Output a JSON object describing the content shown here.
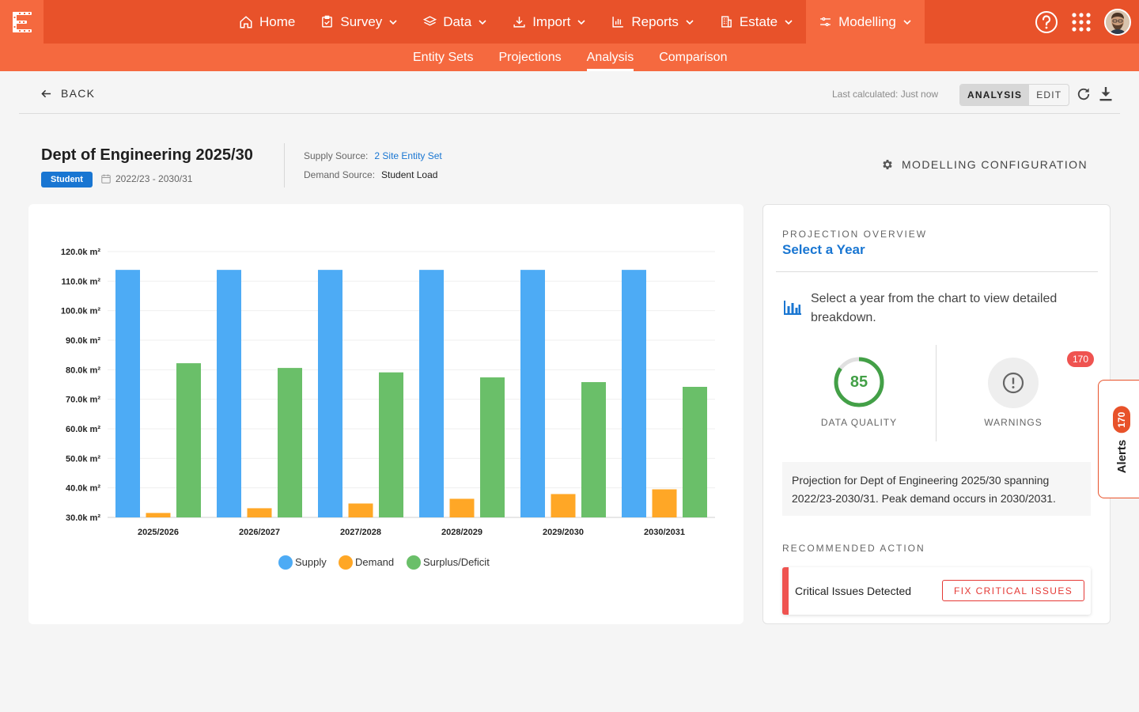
{
  "nav": {
    "items": [
      {
        "label": "Home",
        "icon": "home-icon",
        "dropdown": false
      },
      {
        "label": "Survey",
        "icon": "clipboard-check-icon",
        "dropdown": true
      },
      {
        "label": "Data",
        "icon": "layers-icon",
        "dropdown": true
      },
      {
        "label": "Import",
        "icon": "download-icon",
        "dropdown": true
      },
      {
        "label": "Reports",
        "icon": "bar-chart-icon",
        "dropdown": true
      },
      {
        "label": "Estate",
        "icon": "building-icon",
        "dropdown": true
      },
      {
        "label": "Modelling",
        "icon": "sliders-icon",
        "dropdown": true,
        "active": true
      }
    ]
  },
  "subnav": {
    "items": [
      {
        "label": "Entity Sets"
      },
      {
        "label": "Projections"
      },
      {
        "label": "Analysis",
        "active": true
      },
      {
        "label": "Comparison"
      }
    ]
  },
  "toolbar": {
    "back_label": "BACK",
    "last_calculated": "Last calculated: Just now",
    "view_toggle": {
      "analysis": "ANALYSIS",
      "edit": "EDIT",
      "selected": "ANALYSIS"
    }
  },
  "header": {
    "title": "Dept of Engineering 2025/30",
    "badge": "Student",
    "date_range": "2022/23 - 2030/31",
    "supply_label": "Supply Source:",
    "supply_value": "2 Site Entity Set",
    "demand_label": "Demand Source:",
    "demand_value": "Student Load",
    "config_label": "MODELLING CONFIGURATION"
  },
  "chart_data": {
    "type": "bar",
    "categories": [
      "2025/2026",
      "2026/2027",
      "2027/2028",
      "2028/2029",
      "2029/2030",
      "2030/2031"
    ],
    "series": [
      {
        "name": "Supply",
        "color": "#4dabf5",
        "values": [
          113.8,
          113.8,
          113.8,
          113.8,
          113.8,
          113.8
        ]
      },
      {
        "name": "Demand",
        "color": "#ffa726",
        "values": [
          31.5,
          33.1,
          34.7,
          36.3,
          37.9,
          39.5
        ]
      },
      {
        "name": "Surplus/Deficit",
        "color": "#6abf69",
        "values": [
          82.2,
          80.6,
          79.1,
          77.4,
          75.8,
          74.2
        ]
      }
    ],
    "y_ticks": [
      "30.0k m²",
      "40.0k m²",
      "50.0k m²",
      "60.0k m²",
      "70.0k m²",
      "80.0k m²",
      "90.0k m²",
      "100.0k m²",
      "110.0k m²",
      "120.0k m²"
    ],
    "ylim": [
      30,
      120
    ],
    "unit": "k m²",
    "grid": true,
    "legend": "bottom-center"
  },
  "overview": {
    "eyebrow": "PROJECTION OVERVIEW",
    "title": "Select a Year",
    "hint": "Select a year from the chart to view detailed breakdown.",
    "data_quality_label": "DATA QUALITY",
    "data_quality_value": "85",
    "data_quality_score": 85,
    "warnings_label": "WARNINGS",
    "warnings_count": "170",
    "summary": "Projection for Dept of Engineering 2025/30 spanning 2022/23-2030/31. Peak demand occurs in 2030/2031.",
    "rec_eyebrow": "RECOMMENDED ACTION",
    "rec_text": "Critical Issues Detected",
    "rec_button": "FIX CRITICAL ISSUES"
  },
  "alerts": {
    "label": "Alerts",
    "count": "170"
  },
  "colors": {
    "brand": "#e8522a",
    "brand_light": "#f5693f",
    "link": "#1976d2",
    "danger": "#ef5350",
    "success": "#43a047"
  }
}
